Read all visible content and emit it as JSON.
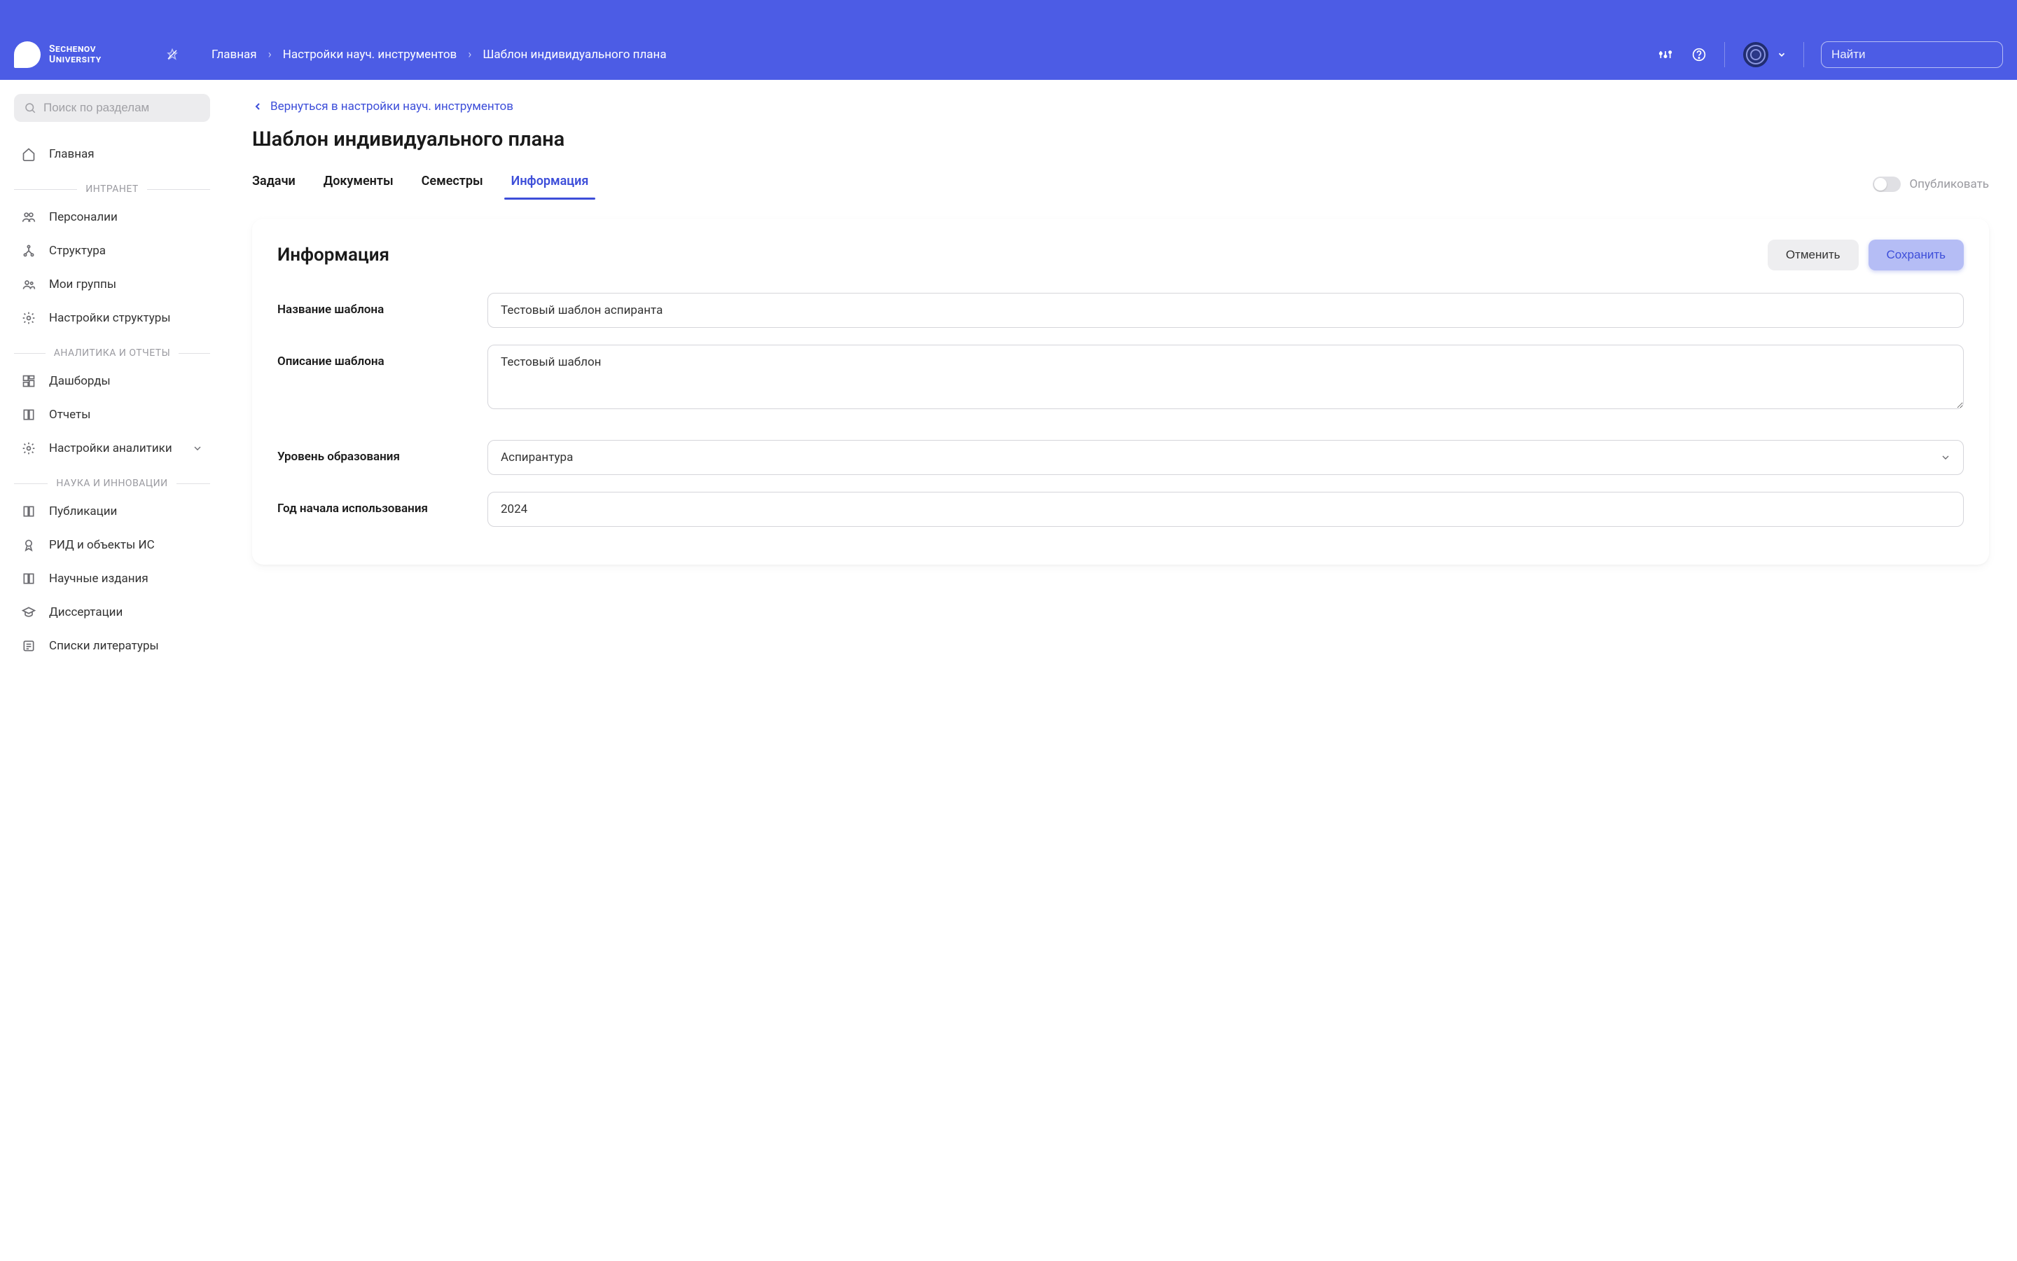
{
  "header": {
    "logo_line1": "Sechenov",
    "logo_line2": "University",
    "breadcrumb": [
      "Главная",
      "Настройки науч. инструментов",
      "Шаблон индивидуального плана"
    ],
    "search_placeholder": "Найти"
  },
  "sidebar": {
    "search_placeholder": "Поиск по разделам",
    "top": [
      {
        "label": "Главная",
        "icon": "home"
      }
    ],
    "sections": [
      {
        "title": "ИНТРАНЕТ",
        "items": [
          {
            "label": "Персоналии",
            "icon": "users"
          },
          {
            "label": "Структура",
            "icon": "network"
          },
          {
            "label": "Мои группы",
            "icon": "group"
          },
          {
            "label": "Настройки структуры",
            "icon": "gear"
          }
        ]
      },
      {
        "title": "АНАЛИТИКА И ОТЧЕТЫ",
        "items": [
          {
            "label": "Дашборды",
            "icon": "dashboard"
          },
          {
            "label": "Отчеты",
            "icon": "book"
          },
          {
            "label": "Настройки аналитики",
            "icon": "gear",
            "expandable": true
          }
        ]
      },
      {
        "title": "НАУКА И ИННОВАЦИИ",
        "items": [
          {
            "label": "Публикации",
            "icon": "book"
          },
          {
            "label": "РИД и объекты ИС",
            "icon": "award"
          },
          {
            "label": "Научные издания",
            "icon": "book"
          },
          {
            "label": "Диссертации",
            "icon": "cap"
          },
          {
            "label": "Списки литературы",
            "icon": "list"
          }
        ]
      }
    ]
  },
  "main": {
    "back_label": "Вернуться в настройки науч. инструментов",
    "title": "Шаблон индивидуального плана",
    "tabs": [
      "Задачи",
      "Документы",
      "Семестры",
      "Информация"
    ],
    "active_tab": 3,
    "publish_label": "Опубликовать",
    "card": {
      "title": "Информация",
      "cancel": "Отменить",
      "save": "Сохранить",
      "fields": {
        "name_label": "Название шаблона",
        "name_value": "Тестовый шаблон аспиранта",
        "desc_label": "Описание шаблона",
        "desc_value": "Тестовый шаблон",
        "level_label": "Уровень образования",
        "level_value": "Аспирантура",
        "year_label": "Год начала использования",
        "year_value": "2024"
      }
    }
  }
}
